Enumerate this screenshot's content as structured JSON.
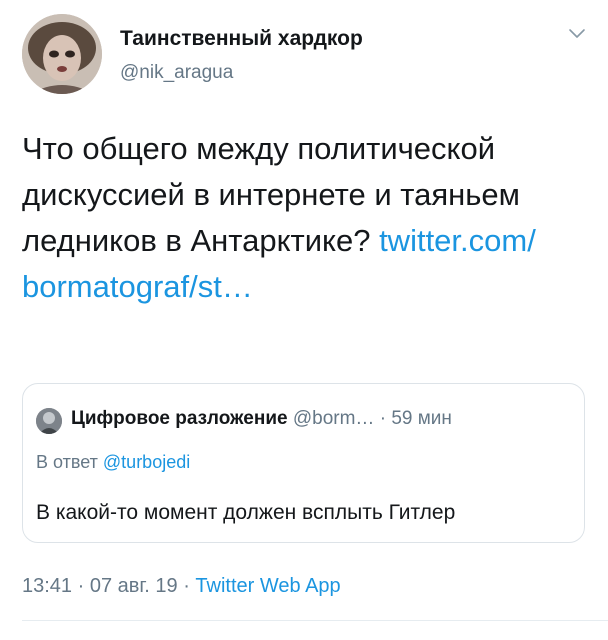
{
  "tweet": {
    "author": {
      "display_name": "Таинственный хардкор",
      "handle": "@nik_aragua",
      "avatar_icon": "user-avatar-icon"
    },
    "text_plain": "Что общего между политической дискуссией в интернете и таяньем ледников в Антарктике?",
    "link_text_line1": "twitter.com/",
    "link_text_line2": "bormatograf/st…",
    "menu_icon": "chevron-down-icon"
  },
  "quoted_tweet": {
    "display_name": "Цифровое разложение",
    "handle": "@borm…",
    "separator": "·",
    "time_ago": "59 мин",
    "reply_prefix": "В ответ",
    "reply_to": "@turbojedi",
    "text": "В какой-то момент должен всплыть Гитлер"
  },
  "footer": {
    "time": "13:41",
    "date": "07 авг. 19",
    "separator": "·",
    "source": "Twitter Web App"
  },
  "colors": {
    "text": "#14171a",
    "secondary": "#657786",
    "link": "#1b95e0",
    "border": "#dde3e8"
  }
}
